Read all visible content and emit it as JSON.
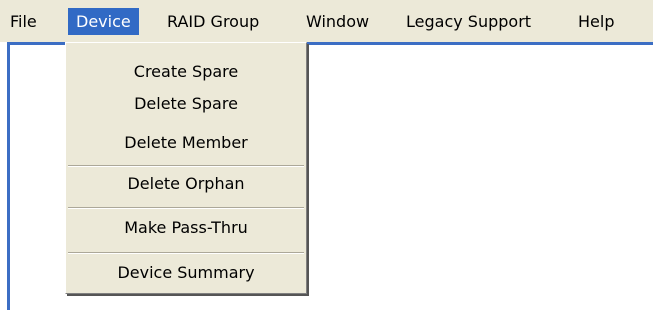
{
  "menubar": {
    "items": [
      {
        "label": "File"
      },
      {
        "label": "Device"
      },
      {
        "label": "RAID Group"
      },
      {
        "label": "Window"
      },
      {
        "label": "Legacy Support"
      },
      {
        "label": "Help"
      }
    ]
  },
  "device_menu": {
    "items": [
      {
        "label": "Create Spare"
      },
      {
        "label": "Delete Spare"
      },
      {
        "label": "Delete Member"
      },
      {
        "label": "Delete Orphan"
      },
      {
        "label": "Make Pass-Thru"
      },
      {
        "label": "Device Summary"
      }
    ]
  },
  "colors": {
    "menu_background": "#ece9d8",
    "active_highlight": "#316ac5",
    "client_border": "#3c6ec4"
  }
}
